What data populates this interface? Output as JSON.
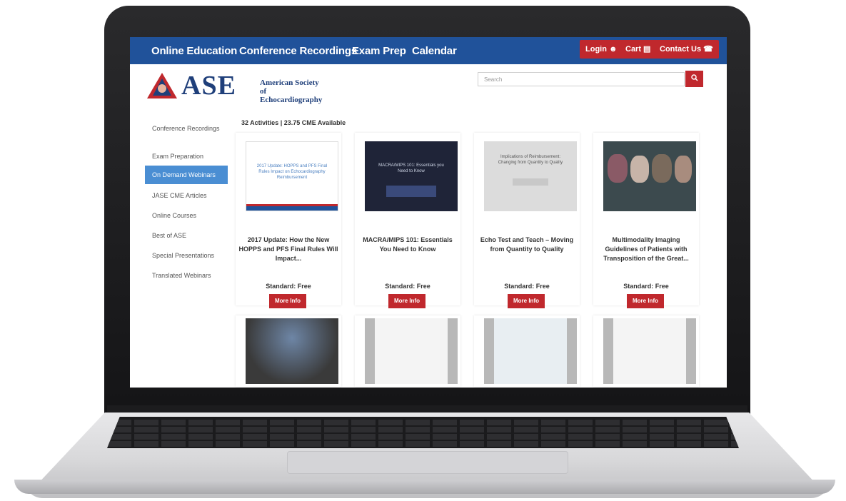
{
  "nav": {
    "links": [
      "Online Education",
      "Conference Recordings",
      "Exam Prep",
      "Calendar"
    ],
    "login_label": "Login ☻",
    "cart_label": "Cart ▤",
    "contact_label": "Contact Us ☎"
  },
  "logo": {
    "acronym": "ASE",
    "line1": "American Society of",
    "line2": "Echocardiography"
  },
  "search": {
    "placeholder": "Search",
    "button_icon": "search-icon"
  },
  "sidebar": {
    "items": [
      {
        "label": "Conference Recordings",
        "active": false
      },
      {
        "label": "Exam Preparation",
        "active": false
      },
      {
        "label": "On Demand Webinars",
        "active": true
      },
      {
        "label": "JASE CME Articles",
        "active": false
      },
      {
        "label": "Online Courses",
        "active": false
      },
      {
        "label": "Best of ASE",
        "active": false
      },
      {
        "label": "Special Presentations",
        "active": false
      },
      {
        "label": "Translated Webinars",
        "active": false
      }
    ]
  },
  "listing": {
    "summary": "32 Activities | 23.75 CME Available"
  },
  "cards": [
    {
      "title": "2017 Update: How the New HOPPS and PFS Final Rules Will Impact...",
      "price": "Standard: Free",
      "button": "More Info",
      "thumb_text": "2017 Update: HOPPS and PFS Final Rules Impact on Echocardiography Reimbursement"
    },
    {
      "title": "MACRA/MIPS 101: Essentials You Need to Know",
      "price": "Standard: Free",
      "button": "More Info",
      "thumb_text": "MACRA/MIPS 101: Essentials you Need to Know"
    },
    {
      "title": "Echo Test and Teach – Moving from Quantity to Quality",
      "price": "Standard: Free",
      "button": "More Info",
      "thumb_text": "Implications of Reimbursement: Changing from Quantity to Quality"
    },
    {
      "title": "Multimodality Imaging Guidelines of Patients with Transposition of the Great...",
      "price": "Standard: Free",
      "button": "More Info",
      "thumb_text": ""
    }
  ],
  "colors": {
    "nav_blue": "#20529a",
    "accent_red": "#c0282d",
    "sidebar_active": "#4a8ed3"
  }
}
